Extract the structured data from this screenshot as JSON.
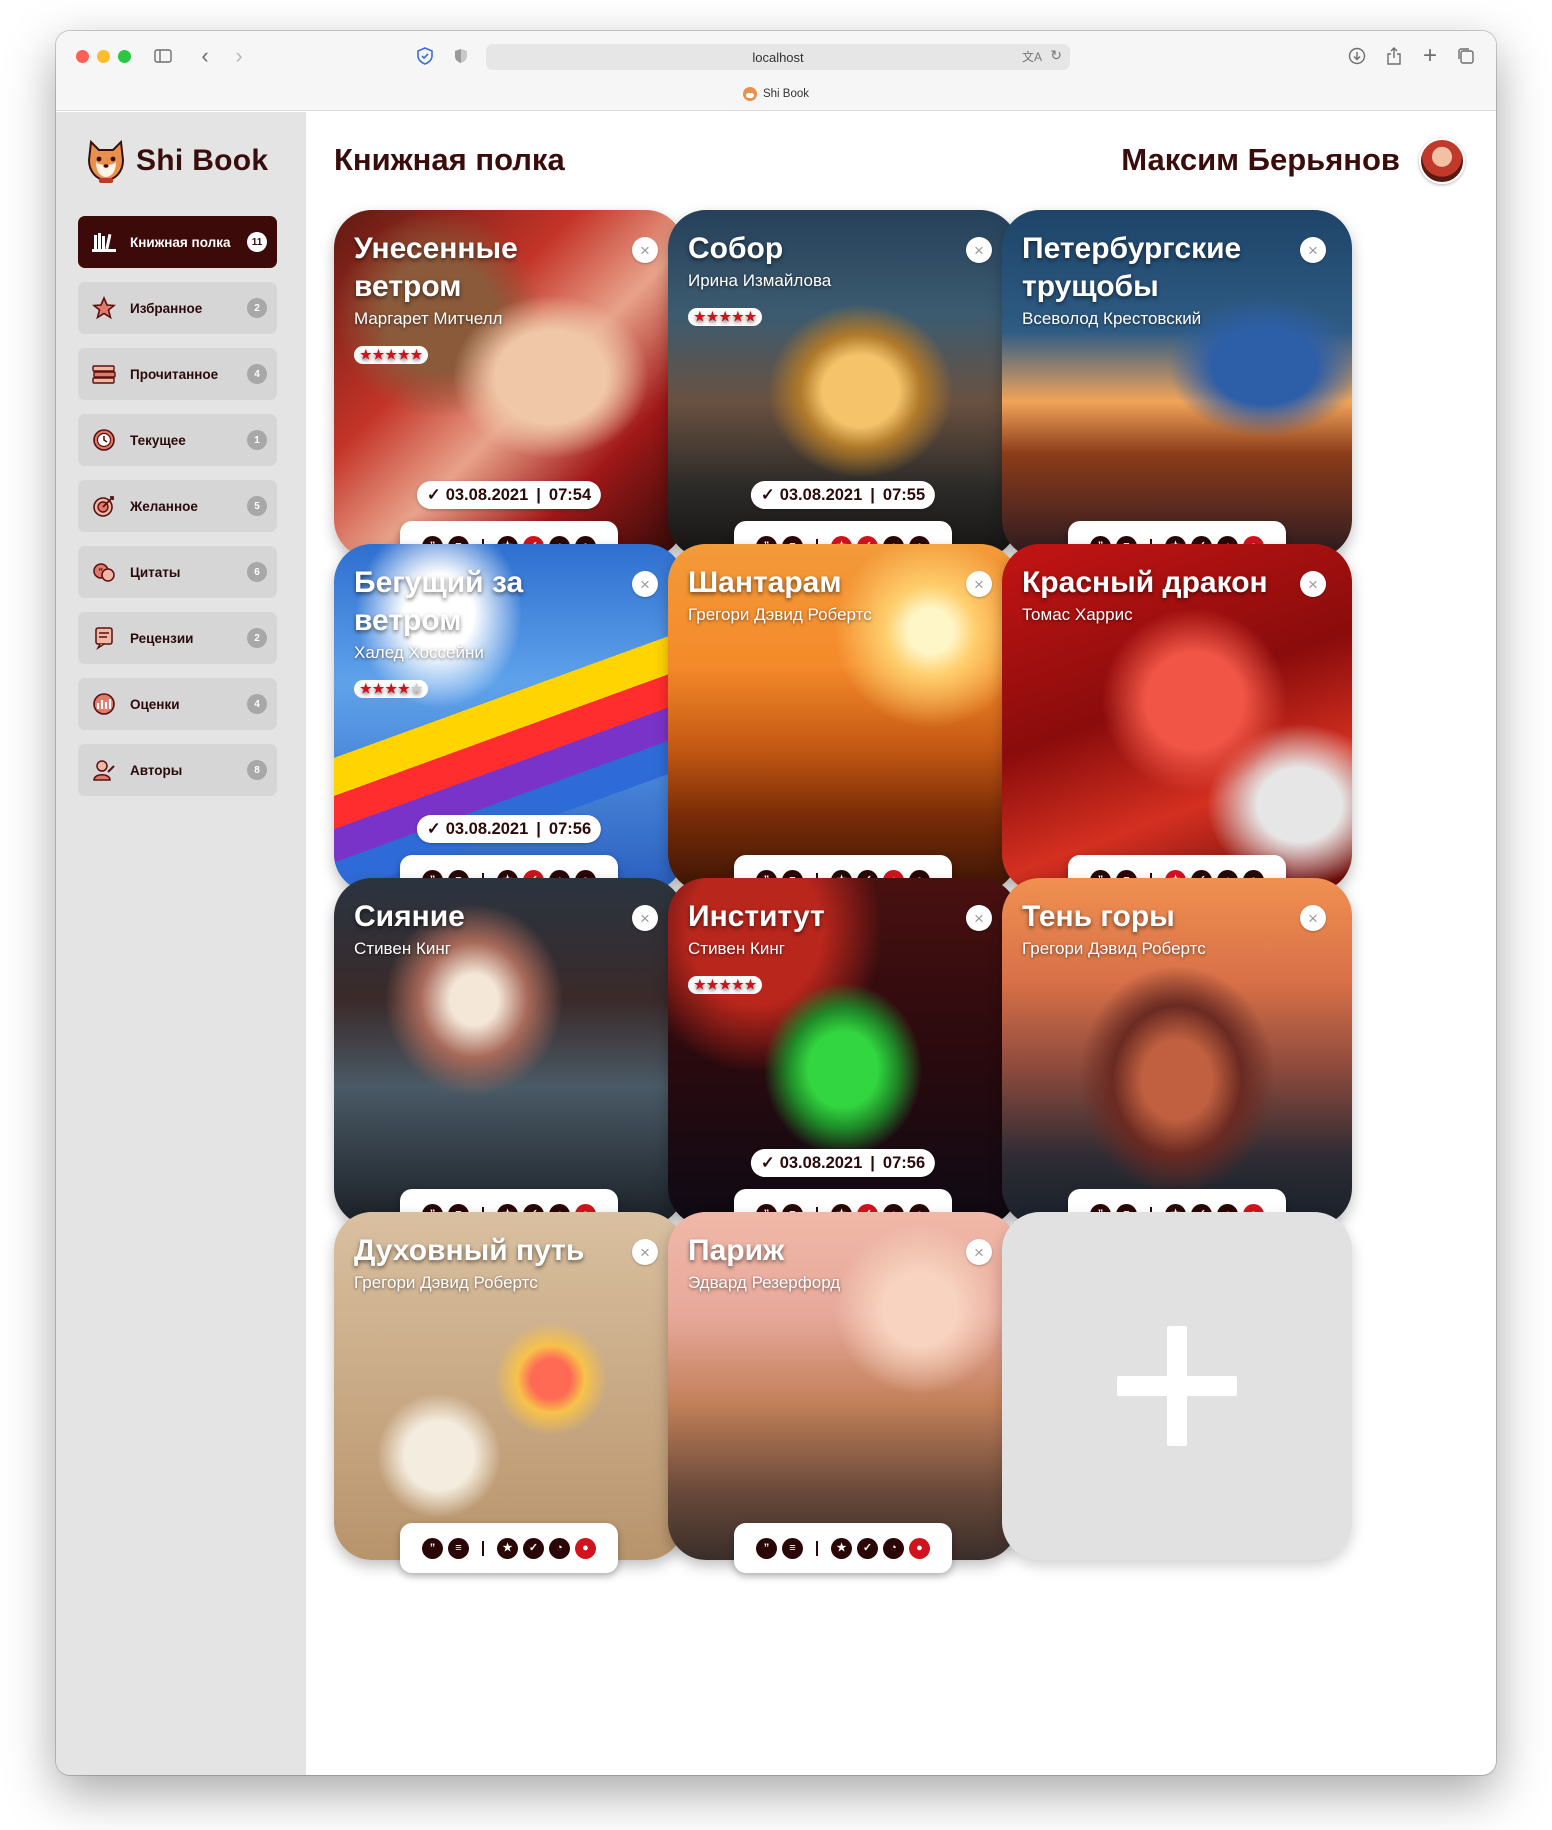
{
  "browser": {
    "address": "localhost",
    "tab_title": "Shi Book"
  },
  "app": {
    "brand": "Shi Book",
    "page_title": "Книжная полка",
    "user_name": "Максим Берьянов"
  },
  "colors": {
    "accent": "#3d0a0a",
    "status_red": "#d0141e",
    "sidebar_bg": "#e4e4e4"
  },
  "nav": [
    {
      "label": "Книжная полка",
      "count": "11",
      "icon": "bookshelf-icon",
      "active": true
    },
    {
      "label": "Избранное",
      "count": "2",
      "icon": "star-icon",
      "active": false
    },
    {
      "label": "Прочитанное",
      "count": "4",
      "icon": "books-stack-icon",
      "active": false
    },
    {
      "label": "Текущее",
      "count": "1",
      "icon": "clock-icon",
      "active": false
    },
    {
      "label": "Желанное",
      "count": "5",
      "icon": "target-icon",
      "active": false
    },
    {
      "label": "Цитаты",
      "count": "6",
      "icon": "quote-icon",
      "active": false
    },
    {
      "label": "Рецензии",
      "count": "2",
      "icon": "review-icon",
      "active": false
    },
    {
      "label": "Оценки",
      "count": "4",
      "icon": "rating-icon",
      "active": false
    },
    {
      "label": "Авторы",
      "count": "8",
      "icon": "author-icon",
      "active": false
    }
  ],
  "books": [
    {
      "title": "Унесенные ветром",
      "author": "Маргарет Митчелл",
      "rating": 5,
      "date": "03.08.2021",
      "time": "07:54",
      "icons": [
        "quote",
        "review",
        "star",
        "check-red",
        "clock",
        "bulb"
      ]
    },
    {
      "title": "Собор",
      "author": "Ирина Измайлова",
      "rating": 5,
      "date": "03.08.2021",
      "time": "07:55",
      "icons": [
        "quote",
        "review",
        "star-red",
        "check-red",
        "clock",
        "bulb"
      ]
    },
    {
      "title": "Петербургские трущобы",
      "author": "Всеволод Крестовский",
      "rating": 0,
      "date": "",
      "time": "",
      "icons": [
        "quote",
        "review",
        "star",
        "check",
        "clock",
        "bulb-red"
      ]
    },
    {
      "title": "Бегущий за ветром",
      "author": "Халед Хоссейни",
      "rating": 4,
      "date": "03.08.2021",
      "time": "07:56",
      "icons": [
        "quote",
        "review",
        "star",
        "check-red",
        "clock",
        "bulb"
      ]
    },
    {
      "title": "Шантарам",
      "author": "Грегори Дэвид Робертс",
      "rating": 0,
      "date": "",
      "time": "",
      "icons": [
        "quote",
        "review",
        "star",
        "check",
        "clock-red",
        "bulb"
      ]
    },
    {
      "title": "Красный дракон",
      "author": "Томас Харрис",
      "rating": 0,
      "date": "",
      "time": "",
      "icons": [
        "quote",
        "review",
        "star-red",
        "check",
        "clock",
        "bulb"
      ]
    },
    {
      "title": "Сияние",
      "author": "Стивен Кинг",
      "rating": 0,
      "date": "",
      "time": "",
      "icons": [
        "quote",
        "review",
        "star",
        "check",
        "clock",
        "bulb-red"
      ]
    },
    {
      "title": "Институт",
      "author": "Стивен Кинг",
      "rating": 5,
      "date": "03.08.2021",
      "time": "07:56",
      "icons": [
        "quote",
        "review",
        "star",
        "check-red",
        "clock",
        "bulb"
      ]
    },
    {
      "title": "Тень горы",
      "author": "Грегори Дэвид Робертс",
      "rating": 0,
      "date": "",
      "time": "",
      "icons": [
        "quote",
        "review",
        "star",
        "check",
        "clock",
        "bulb-red"
      ]
    },
    {
      "title": "Духовный путь",
      "author": "Грегори Дэвид Робертс",
      "rating": 0,
      "date": "",
      "time": "",
      "icons": [
        "quote",
        "review",
        "star",
        "check",
        "clock",
        "bulb-red"
      ]
    },
    {
      "title": "Париж",
      "author": "Эдвард Резерфорд",
      "rating": 0,
      "date": "",
      "time": "",
      "icons": [
        "quote",
        "review",
        "star",
        "check",
        "clock",
        "bulb-red"
      ]
    }
  ],
  "add_card": {
    "icon": "plus-icon"
  }
}
